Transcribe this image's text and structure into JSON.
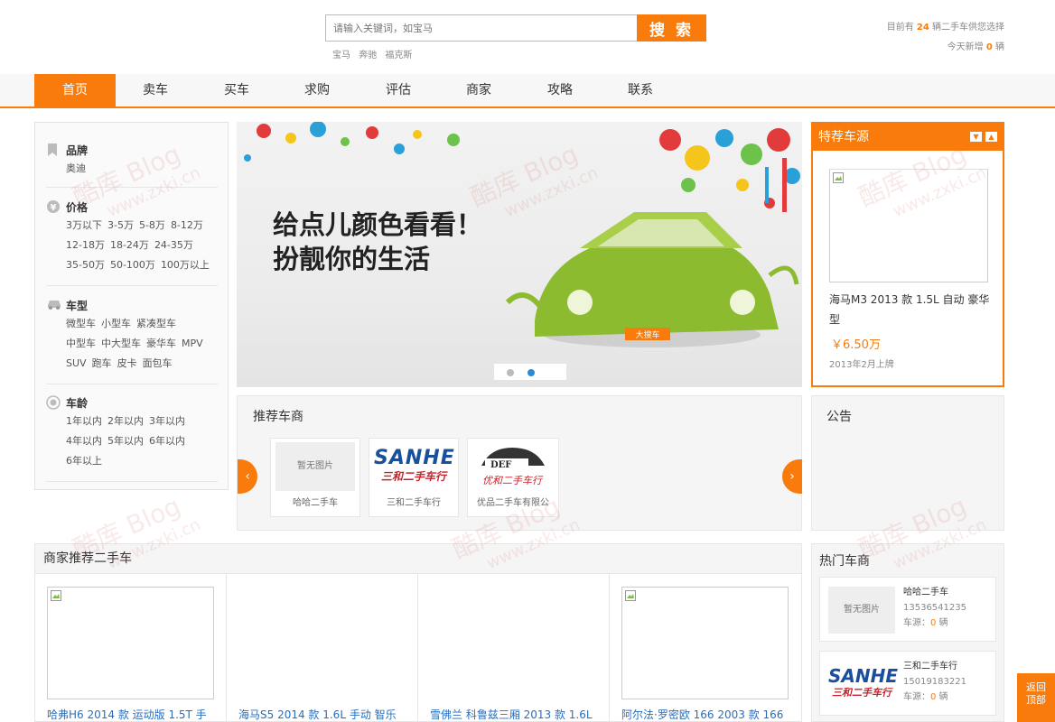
{
  "search": {
    "placeholder": "请输入关键词，如宝马",
    "button_label": "搜 索",
    "hot_keywords": [
      "宝马",
      "奔驰",
      "福克斯"
    ]
  },
  "stats": {
    "line1_prefix": "目前有 ",
    "count": "24",
    "line1_suffix": " 辆二手车供您选择",
    "line2_prefix": "今天新增 ",
    "new_count": "0",
    "line2_suffix": " 辆"
  },
  "nav": {
    "items": [
      {
        "label": "首页",
        "active": true
      },
      {
        "label": "卖车"
      },
      {
        "label": "买车"
      },
      {
        "label": "求购"
      },
      {
        "label": "评估"
      },
      {
        "label": "商家"
      },
      {
        "label": "攻略"
      },
      {
        "label": "联系"
      }
    ]
  },
  "filters": {
    "brand": {
      "title": "品牌",
      "icon": "bookmark-icon",
      "options": [
        "奥迪"
      ]
    },
    "price": {
      "title": "价格",
      "icon": "coin-icon",
      "options": [
        "3万以下",
        "3-5万",
        "5-8万",
        "8-12万",
        "12-18万",
        "18-24万",
        "24-35万",
        "35-50万",
        "50-100万",
        "100万以上"
      ]
    },
    "type": {
      "title": "车型",
      "icon": "car-icon",
      "options": [
        "微型车",
        "小型车",
        "紧凑型车",
        "中型车",
        "中大型车",
        "豪华车",
        "MPV",
        "SUV",
        "跑车",
        "皮卡",
        "面包车"
      ]
    },
    "age": {
      "title": "车龄",
      "icon": "target-icon",
      "options": [
        "1年以内",
        "2年以内",
        "3年以内",
        "4年以内",
        "5年以内",
        "6年以内",
        "6年以上"
      ]
    }
  },
  "banner": {
    "line1": "给点儿颜色看看！",
    "line2": "扮靓你的生活",
    "plate": "大搜车"
  },
  "featured": {
    "title": "特荐车源",
    "car_name": "海马M3 2013 款 1.5L 自动 豪华型",
    "price": "￥6.50万",
    "date": "2013年2月上牌"
  },
  "rec_dealers": {
    "title": "推荐车商",
    "items": [
      {
        "name": "哈哈二手车",
        "logo_text": "暂无图片"
      },
      {
        "name": "三和二手车行",
        "logo_text": "SANHE"
      },
      {
        "name": "优品二手车有限公",
        "logo_text": "DEF"
      }
    ]
  },
  "notice": {
    "title": "公告"
  },
  "dealer_cars": {
    "title": "商家推荐二手车",
    "items": [
      {
        "name": "哈弗H6 2014 款 运动版 1.5T 手"
      },
      {
        "name": "海马S5 2014 款 1.6L 手动 智乐"
      },
      {
        "name": "雪佛兰 科鲁兹三厢 2013 款 1.6L"
      },
      {
        "name": "阿尔法·罗密欧 166 2003 款 166"
      }
    ]
  },
  "hot_dealers": {
    "title": "热门车商",
    "items": [
      {
        "name": "哈哈二手车",
        "tel": "13536541235",
        "src_label": "车源：",
        "src_count": "0",
        "src_unit": " 辆",
        "logo_text": "暂无图片"
      },
      {
        "name": "三和二手车行",
        "tel": "15019183221",
        "src_label": "车源：",
        "src_count": "0",
        "src_unit": " 辆",
        "logo_text": "SANHE"
      }
    ]
  },
  "back_top": {
    "line1": "返回",
    "line2": "顶部"
  },
  "colors": {
    "accent": "#f97b0b",
    "link": "#2a6ebb"
  }
}
